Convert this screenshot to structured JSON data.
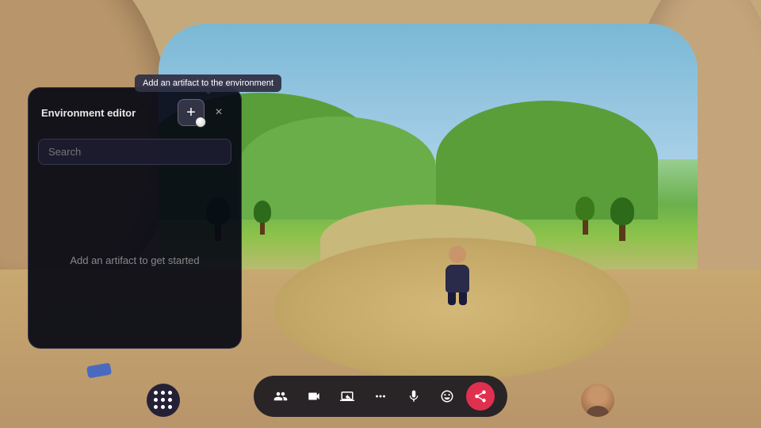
{
  "background": {
    "description": "3D virtual environment with sandy walls and a window showing outdoor scene"
  },
  "tooltip": {
    "text": "Add an artifact to the environment"
  },
  "panel": {
    "title": "Environment editor",
    "add_button_label": "+",
    "close_button_label": "×",
    "search_placeholder": "Search",
    "empty_message": "Add an artifact to get started"
  },
  "toolbar": {
    "buttons": [
      {
        "name": "people",
        "label": "People",
        "icon": "people"
      },
      {
        "name": "camera",
        "label": "Camera",
        "icon": "camera"
      },
      {
        "name": "screen-share",
        "label": "Screen share",
        "icon": "screen"
      },
      {
        "name": "more",
        "label": "More",
        "icon": "more"
      },
      {
        "name": "microphone",
        "label": "Microphone",
        "icon": "mic"
      },
      {
        "name": "emoji",
        "label": "Emoji",
        "icon": "emoji"
      },
      {
        "name": "share",
        "label": "Share",
        "icon": "share",
        "active": true
      }
    ]
  },
  "left_menu": {
    "label": "Apps"
  },
  "right_avatar": {
    "label": "User avatar"
  }
}
